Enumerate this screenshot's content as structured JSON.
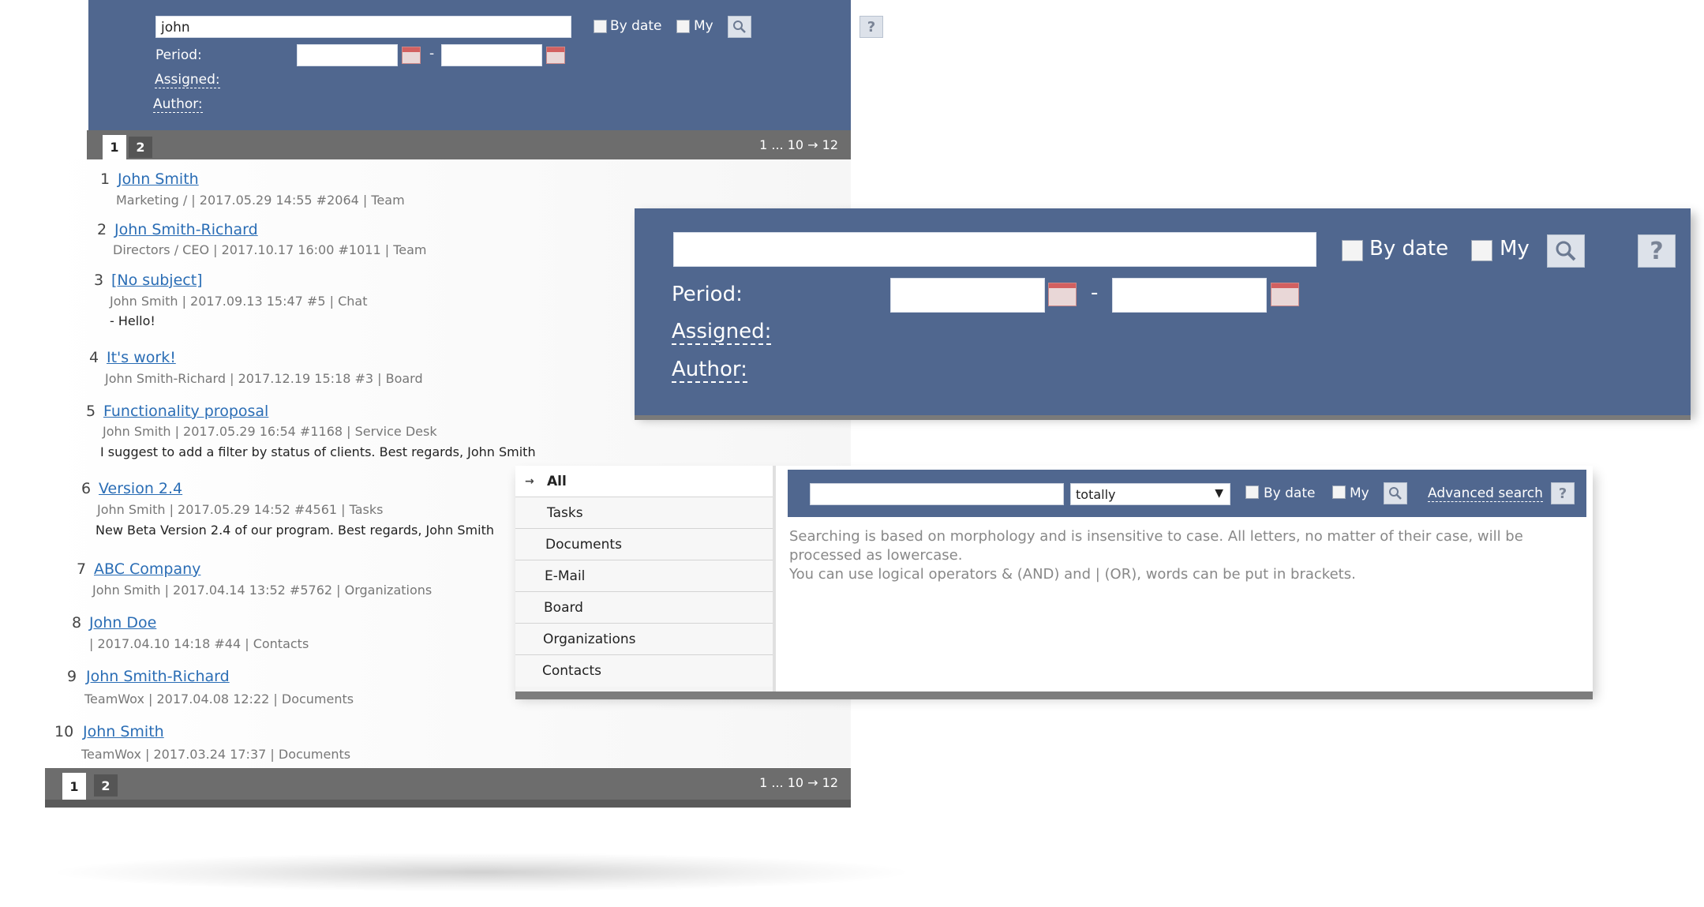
{
  "search_panel": {
    "query": "john",
    "by_date_label": "By date",
    "my_label": "My",
    "help_label": "?",
    "period_label": "Period:",
    "date_separator": "-",
    "assigned_label": "Assigned:",
    "author_label": "Author:"
  },
  "pager_top": {
    "pages": [
      "1",
      "2"
    ],
    "range": "1 ... 10 → 12"
  },
  "pager_bottom": {
    "pages": [
      "1",
      "2"
    ],
    "range": "1 ... 10 → 12"
  },
  "results": [
    {
      "num": "1",
      "title": "John Smith",
      "meta": "Marketing / | 2017.05.29 14:55  #2064 | Team",
      "snippet": ""
    },
    {
      "num": "2",
      "title": "John Smith-Richard",
      "meta": "Directors / CEO | 2017.10.17 16:00  #1011 | Team",
      "snippet": ""
    },
    {
      "num": "3",
      "title": "[No subject]",
      "meta": "John Smith | 2017.09.13 15:47  #5 | Chat",
      "snippet": "- Hello!"
    },
    {
      "num": "4",
      "title": "It's work!",
      "meta": "John Smith-Richard | 2017.12.19 15:18  #3 | Board",
      "snippet": ""
    },
    {
      "num": "5",
      "title": "Functionality proposal",
      "meta": "John Smith | 2017.05.29 16:54  #1168 | Service Desk",
      "snippet": "I suggest to add a filter by status of clients. Best regards, John Smith"
    },
    {
      "num": "6",
      "title": "Version 2.4",
      "meta": "John Smith | 2017.05.29 14:52  #4561 | Tasks",
      "snippet": "New Beta Version 2.4 of our program. Best regards, John Smith"
    },
    {
      "num": "7",
      "title": "ABC Company",
      "meta": "John Smith | 2017.04.14 13:52  #5762 | Organizations",
      "snippet": ""
    },
    {
      "num": "8",
      "title": "John Doe",
      "meta": "| 2017.04.10 14:18  #44 | Contacts",
      "snippet": ""
    },
    {
      "num": "9",
      "title": "John Smith-Richard",
      "meta": "TeamWox | 2017.04.08 12:22 | Documents",
      "snippet": ""
    },
    {
      "num": "10",
      "title": "John Smith",
      "meta": "TeamWox | 2017.03.24 17:37 | Documents",
      "snippet": ""
    }
  ],
  "big_header": {
    "query": "",
    "by_date_label": "By date",
    "my_label": "My",
    "help_label": "?",
    "period_label": "Period:",
    "date_separator": "-",
    "assigned_label": "Assigned:",
    "author_label": "Author:"
  },
  "advanced": {
    "categories": [
      "All",
      "Tasks",
      "Documents",
      "E-Mail",
      "Board",
      "Organizations",
      "Contacts"
    ],
    "query": "",
    "mode_value": "totally",
    "by_date_label": "By date",
    "my_label": "My",
    "advanced_link": "Advanced search",
    "help_label": "?",
    "help_line1": "Searching is based on morphology and is insensitive to case. All letters, no matter of their case, will be processed as lowercase.",
    "help_line2": "You can use logical operators & (AND) and | (OR), words can be put in brackets."
  },
  "colors": {
    "header_bg": "#50678f",
    "link": "#2a6db5",
    "pager_bg": "#6d6d6d"
  },
  "icons": [
    "search-icon",
    "help-icon",
    "calendar-icon",
    "arrow-right-icon",
    "dropdown-arrow-icon"
  ]
}
